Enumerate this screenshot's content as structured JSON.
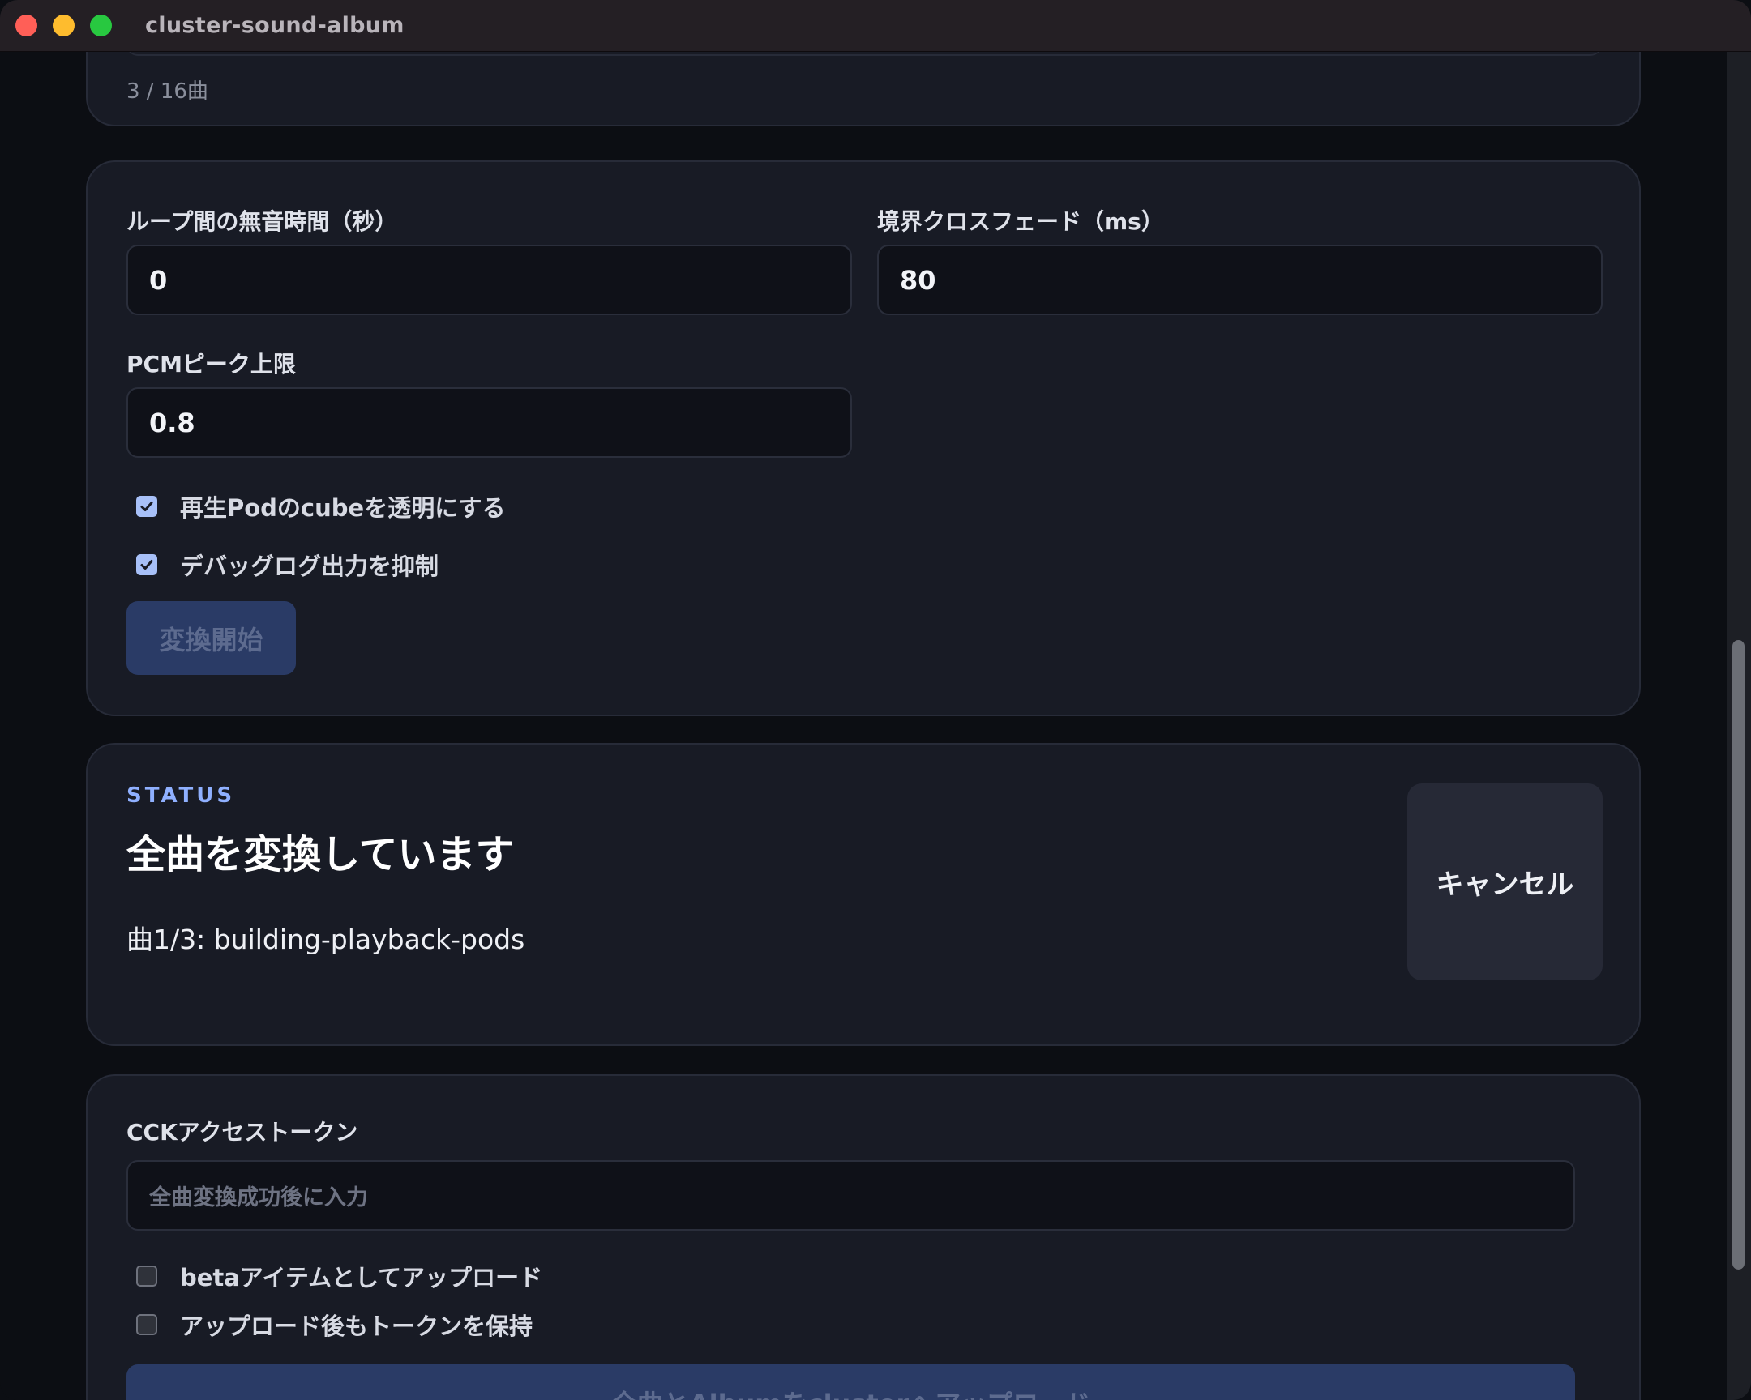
{
  "window": {
    "title": "cluster-sound-album"
  },
  "top_card": {
    "track_count": "3 / 16曲"
  },
  "settings": {
    "loop_gap_label": "ループ間の無音時間（秒）",
    "loop_gap_value": "0",
    "crossfade_label": "境界クロスフェード（ms）",
    "crossfade_value": "80",
    "pcm_peak_label": "PCMピーク上限",
    "pcm_peak_value": "0.8",
    "transparent_cube_label": "再生Podのcubeを透明にする",
    "transparent_cube_checked": true,
    "suppress_debug_label": "デバッグログ出力を抑制",
    "suppress_debug_checked": true,
    "convert_button": "変換開始"
  },
  "status": {
    "kicker": "STATUS",
    "title": "全曲を変換しています",
    "detail": "曲1/3: building-playback-pods",
    "cancel_button": "キャンセル"
  },
  "upload": {
    "token_label": "CCKアクセストークン",
    "token_placeholder": "全曲変換成功後に入力",
    "beta_label": "betaアイテムとしてアップロード",
    "beta_checked": false,
    "keep_token_label": "アップロード後もトークンを保持",
    "keep_token_checked": false,
    "upload_button": "全曲とAlbumをclusterへアップロード"
  },
  "colors": {
    "accent": "#8fb0ff",
    "card_bg": "#181b25",
    "page_bg": "#0c0e13",
    "disabled_button_bg": "#2a3b66"
  }
}
